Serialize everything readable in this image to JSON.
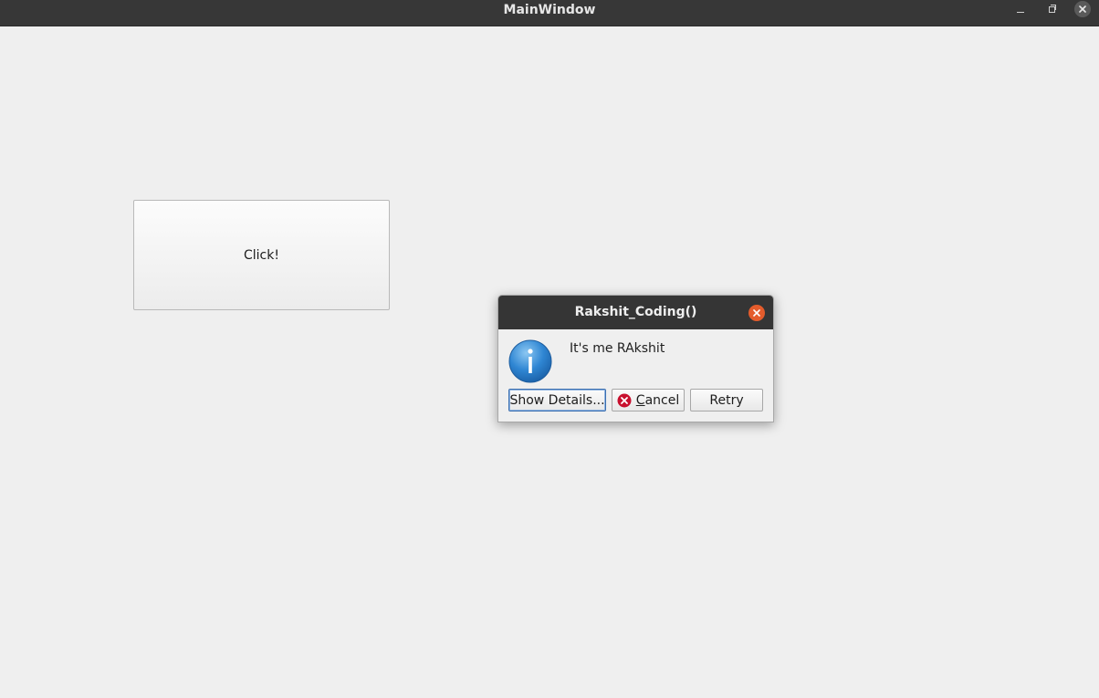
{
  "window": {
    "title": "MainWindow"
  },
  "main": {
    "click_button_label": "Click!"
  },
  "dialog": {
    "title": "Rakshit_Coding()",
    "message": "It's me RAkshit",
    "icon": "information-icon",
    "buttons": {
      "details_label": "Show Details...",
      "cancel_mnemonic": "C",
      "cancel_rest": "ancel",
      "retry_label": "Retry"
    }
  },
  "colors": {
    "titlebar": "#373737",
    "dialog_close": "#e45c2c",
    "info_blue": "#2f86d3",
    "cancel_red": "#c8102e",
    "background": "#efefef"
  }
}
